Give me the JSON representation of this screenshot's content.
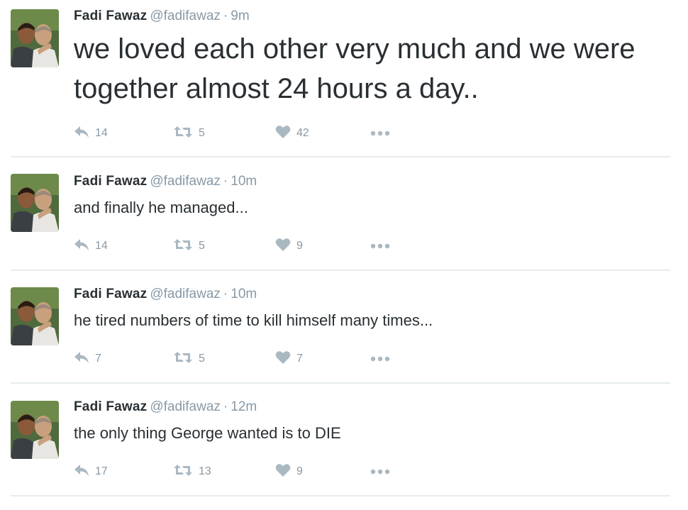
{
  "tweets": [
    {
      "name": "Fadi Fawaz",
      "handle": "@fadifawaz",
      "separator": "·",
      "time": "9m",
      "text": "we loved each other very much and we were together almost 24 hours a day..",
      "replies": "14",
      "retweets": "5",
      "likes": "42"
    },
    {
      "name": "Fadi Fawaz",
      "handle": "@fadifawaz",
      "separator": "·",
      "time": "10m",
      "text": "and finally he managed...",
      "replies": "14",
      "retweets": "5",
      "likes": "9"
    },
    {
      "name": "Fadi Fawaz",
      "handle": "@fadifawaz",
      "separator": "·",
      "time": "10m",
      "text": "he tired numbers of time to kill himself many times...",
      "replies": "7",
      "retweets": "5",
      "likes": "7"
    },
    {
      "name": "Fadi Fawaz",
      "handle": "@fadifawaz",
      "separator": "·",
      "time": "12m",
      "text": "the only thing George wanted is to DIE",
      "replies": "17",
      "retweets": "13",
      "likes": "9"
    }
  ],
  "icons": {
    "reply": "reply-icon",
    "retweet": "retweet-icon",
    "like": "heart-icon",
    "more": "more-icon"
  },
  "colors": {
    "name": "#292f33",
    "meta": "#8899a6",
    "icon": "#aab8c2",
    "divider": "#e6ecf0"
  }
}
